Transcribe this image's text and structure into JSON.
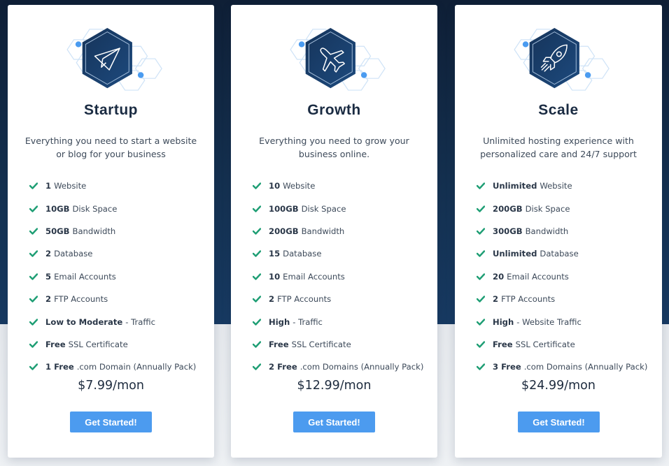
{
  "colors": {
    "background_dark": "#14304f",
    "background_light": "#eceff2",
    "card": "#ffffff",
    "accent_blue": "#4c9bef",
    "check_green": "#1e9e74",
    "title_text": "#1a2b42",
    "body_text": "#3d4a5a"
  },
  "plans": [
    {
      "icon": "paper-plane-icon",
      "title": "Startup",
      "description": "Everything you need to start a website or blog for your business",
      "features": [
        {
          "bold": "1",
          "text": "Website"
        },
        {
          "bold": "10GB",
          "text": "Disk Space"
        },
        {
          "bold": "50GB",
          "text": "Bandwidth"
        },
        {
          "bold": "2",
          "text": "Database"
        },
        {
          "bold": "5",
          "text": "Email Accounts"
        },
        {
          "bold": "2",
          "text": "FTP Accounts"
        },
        {
          "bold": "Low to Moderate",
          "text": "- Traffic"
        },
        {
          "bold": "Free",
          "text": "SSL Certificate"
        },
        {
          "bold": "1 Free",
          "text": ".com Domain (Annually Pack)"
        }
      ],
      "price": "$7.99/mon",
      "cta_label": "Get Started!"
    },
    {
      "icon": "airplane-icon",
      "title": "Growth",
      "description": "Everything you need to grow your business online.",
      "features": [
        {
          "bold": "10",
          "text": "Website"
        },
        {
          "bold": "100GB",
          "text": "Disk Space"
        },
        {
          "bold": "200GB",
          "text": "Bandwidth"
        },
        {
          "bold": "15",
          "text": "Database"
        },
        {
          "bold": "10",
          "text": "Email Accounts"
        },
        {
          "bold": "2",
          "text": "FTP Accounts"
        },
        {
          "bold": "High",
          "text": "- Traffic"
        },
        {
          "bold": "Free",
          "text": "SSL Certificate"
        },
        {
          "bold": "2 Free",
          "text": ".com Domains (Annually Pack)"
        }
      ],
      "price": "$12.99/mon",
      "cta_label": "Get Started!"
    },
    {
      "icon": "rocket-icon",
      "title": "Scale",
      "description": "Unlimited hosting experience with personalized care and 24/7 support",
      "features": [
        {
          "bold": "Unlimited",
          "text": "Website"
        },
        {
          "bold": "200GB",
          "text": "Disk Space"
        },
        {
          "bold": "300GB",
          "text": "Bandwidth"
        },
        {
          "bold": "Unlimited",
          "text": "Database"
        },
        {
          "bold": "20",
          "text": "Email Accounts"
        },
        {
          "bold": "2",
          "text": "FTP Accounts"
        },
        {
          "bold": "High",
          "text": "- Website Traffic"
        },
        {
          "bold": "Free",
          "text": "SSL Certificate"
        },
        {
          "bold": "3 Free",
          "text": ".com Domains (Annually Pack)"
        }
      ],
      "price": "$24.99/mon",
      "cta_label": "Get Started!"
    }
  ]
}
